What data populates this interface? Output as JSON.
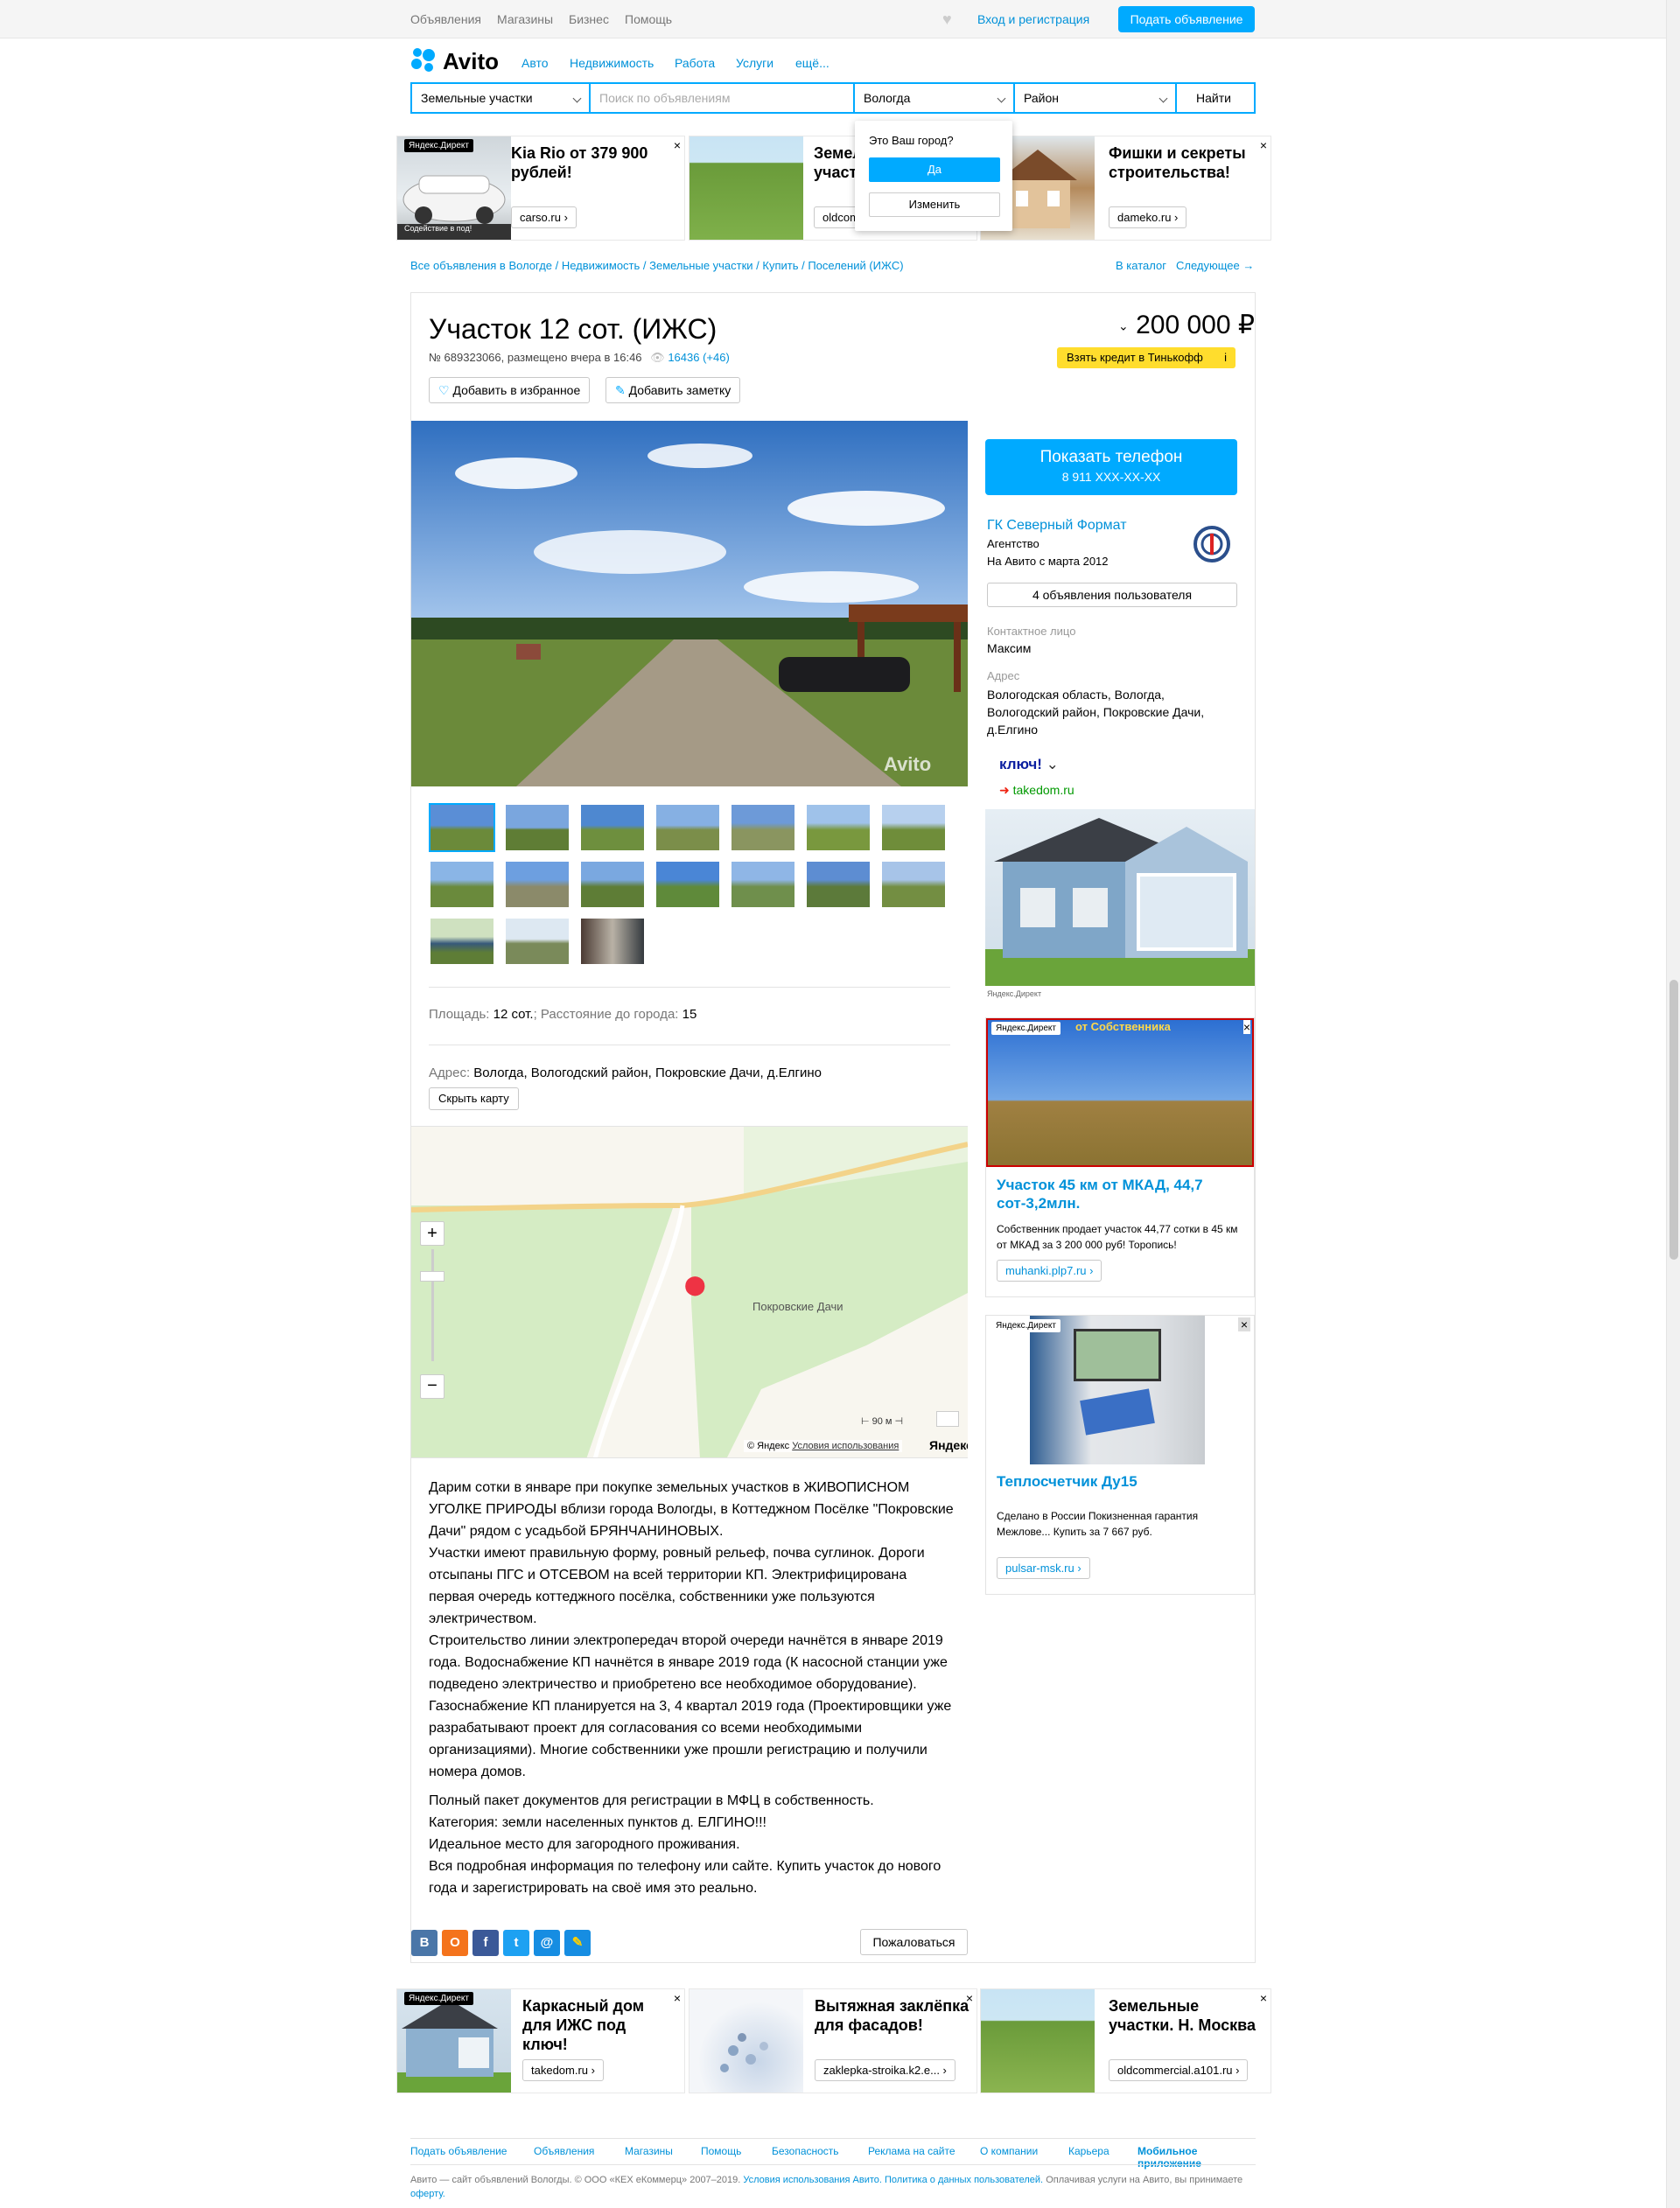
{
  "topbar": {
    "links": [
      "Объявления",
      "Магазины",
      "Бизнес",
      "Помощь"
    ],
    "login": "Вход и регистрация",
    "post_button": "Подать объявление"
  },
  "header": {
    "logo": "Avito",
    "nav": [
      "Авто",
      "Недвижимость",
      "Работа",
      "Услуги",
      "ещё..."
    ]
  },
  "search": {
    "category": "Земельные участки",
    "placeholder": "Поиск по объявлениям",
    "city": "Вологда",
    "district": "Район",
    "submit": "Найти"
  },
  "city_popup": {
    "question": "Это Ваш город?",
    "yes": "Да",
    "change": "Изменить"
  },
  "top_ads": [
    {
      "label": "Яндекс.Директ",
      "title": "Kia Rio от 379 900 рублей!",
      "domain": "carso.ru ›",
      "caption": "Содействие в под!"
    },
    {
      "title": "Земел участ",
      "domain": "oldcom"
    },
    {
      "title": "Фишки и секреты строительства!",
      "domain": "dameko.ru ›"
    }
  ],
  "breadcrumbs": {
    "path": "Все объявления в Вологде / Недвижимость / Земельные участки / Купить / Поселений (ИЖС)",
    "catalog": "В каталог",
    "next": "Следующее →"
  },
  "listing": {
    "title": "Участок 12 сот. (ИЖС)",
    "meta": "№ 689323066, размещено вчера в 16:46",
    "views": "16436 (+46)",
    "add_favorite": "Добавить в избранное",
    "add_note": "Добавить заметку",
    "price": "200 000 ₽",
    "credit": "Взять кредит в Тинькофф",
    "credit_info": "i",
    "watermark": "Avito",
    "params": {
      "area_label": "Площадь:",
      "area_value": "12 сот.",
      "sep": ";",
      "distance_label": "Расстояние до города:",
      "distance_value": "15"
    },
    "address_label": "Адрес:",
    "address_value": "Вологда, Вологодский район, Покровские Дачи, д.Елгино",
    "hide_map": "Скрыть карту",
    "map": {
      "place": "Покровские Дачи",
      "scale": "90 м",
      "copyright": "© Яндекс",
      "terms": "Условия использования",
      "brand": "Яндекс"
    },
    "description": [
      "Дарим сотки в январе при покупке земельных участков в ЖИВОПИСНОМ УГОЛКЕ ПРИРОДЫ вблизи города Вологды, в Коттеджном Посёлке \"Покровские Дачи\" рядом с усадьбой БРЯНЧАНИНОВЫХ.",
      "Участки имеют правильную форму, ровный рельеф, почва суглинок. Дороги отсыпаны ПГС и ОТСЕВОМ на всей территории КП. Электрифицирована первая очередь коттеджного посёлка, собственники уже пользуются электричеством.",
      "Строительство линии электропередач второй очереди начнётся в январе 2019 года. Водоснабжение КП начнётся в январе 2019 года (К насосной станции уже подведено электричество и приобретено все необходимое оборудование).",
      "Газоснабжение КП планируется на 3, 4 квартал 2019 года (Проектировщики уже разрабатывают проект для согласования со всеми необходимыми организациями). Многие собственники уже прошли регистрацию и получили номера домов.",
      "Полный пакет документов для регистрации в МФЦ в собственность.",
      "Категория: земли населенных пунктов д. ЕЛГИНО!!!",
      "Идеальное место для загородного проживания.",
      "Вся подробная информация по телефону или сайте. Купить участок до нового года и зарегистрировать на своё имя это реально."
    ],
    "share": [
      "В",
      "О",
      "f",
      "t",
      "@",
      "✎"
    ],
    "report": "Пожаловаться"
  },
  "seller": {
    "show_phone": "Показать телефон",
    "phone_masked": "8 911 XXX-XX-XX",
    "name": "ГК Северный Формат",
    "type": "Агентство",
    "since": "На Авито с марта 2012",
    "listings": "4 объявления пользователя",
    "contact_label": "Контактное лицо",
    "contact": "Максим",
    "address_label": "Адрес",
    "address": "Вологодская область, Вологда, Вологодский район, Покровские Дачи, д.Елгино"
  },
  "side_ads": [
    {
      "title": "ключ!",
      "domain": "takedom.ru",
      "label": "Яндекс.Директ"
    },
    {
      "label": "Яндекс.Директ",
      "banner": "от Собственника",
      "title": "Участок 45 км от МКАД, 44,7 сот-3,2млн.",
      "text": "Собственник продает участок 44,77 сотки в 45 км от МКАД за 3 200 000 руб! Торопись!",
      "domain": "muhanki.plp7.ru ›"
    },
    {
      "label": "Яндекс.Директ",
      "title": "Теплосчетчик Ду15",
      "text": "Сделано в России Покизненная гарантия Межлове... Купить за 7 667 руб.",
      "domain": "pulsar-msk.ru ›"
    }
  ],
  "bottom_ads": [
    {
      "label": "Яндекс.Директ",
      "title": "Каркасный дом для ИЖС под ключ!",
      "domain": "takedom.ru ›"
    },
    {
      "title": "Вытяжная заклёпка для фасадов!",
      "domain": "zaklepka-stroika.k2.e... ›"
    },
    {
      "title": "Земельные участки. Н. Москва",
      "domain": "oldcommercial.a101.ru ›"
    }
  ],
  "footer": {
    "links": [
      "Подать объявление",
      "Объявления",
      "Магазины",
      "Помощь",
      "Безопасность",
      "Реклама на сайте",
      "О компании",
      "Карьера",
      "Мобильное приложение"
    ],
    "legal1": "Авито — сайт объявлений Вологды. © ООО «КЕХ еКоммерц» 2007–2019.",
    "legal_terms": "Условия использования Авито.",
    "legal_privacy": "Политика о данных пользователей.",
    "legal2": "Оплачивая услуги на Авито, вы принимаете",
    "legal_offer": "оферту."
  },
  "colors": {
    "accent": "#00aaff",
    "link": "#0091d9",
    "credit": "#ffdd2d"
  }
}
